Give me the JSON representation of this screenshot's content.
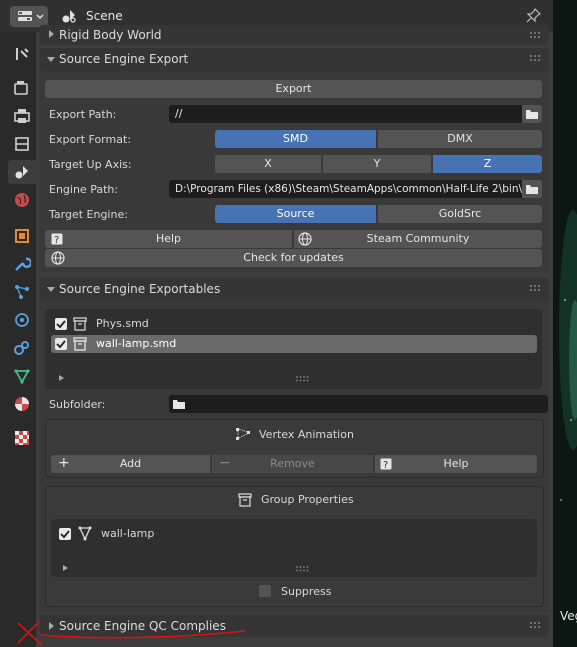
{
  "header": {
    "title": "Scene"
  },
  "panels": {
    "rigid_body_world": {
      "title": "Rigid Body World"
    },
    "source_engine_export": {
      "title": "Source Engine Export",
      "export_button": "Export",
      "export_path_label": "Export Path:",
      "export_path_value": "//",
      "export_format_label": "Export Format:",
      "export_format_options": [
        "SMD",
        "DMX"
      ],
      "export_format_selected": "SMD",
      "target_up_axis_label": "Target Up Axis:",
      "axis_options": [
        "X",
        "Y",
        "Z"
      ],
      "axis_selected": "Z",
      "engine_path_label": "Engine Path:",
      "engine_path_value": "D:\\Program Files (x86)\\Steam\\SteamApps\\common\\Half-Life 2\\bin\\",
      "target_engine_label": "Target Engine:",
      "target_engine_options": [
        "Source",
        "GoldSrc"
      ],
      "target_engine_selected": "Source",
      "help_button": "Help",
      "steam_button": "Steam Community",
      "updates_button": "Check for updates"
    },
    "source_engine_exportables": {
      "title": "Source Engine Exportables",
      "items": [
        {
          "name": "Phys.smd",
          "checked": true,
          "selected": false
        },
        {
          "name": "wall-lamp.smd",
          "checked": true,
          "selected": true
        }
      ],
      "subfolder_label": "Subfolder:",
      "subfolder_value": "",
      "vertex_animation": {
        "title": "Vertex Animation",
        "add": "Add",
        "remove": "Remove",
        "help": "Help"
      },
      "group_properties": {
        "title": "Group Properties",
        "items": [
          {
            "name": "wall-lamp",
            "checked": true
          }
        ],
        "suppress_label": "Suppress",
        "suppress_checked": false
      }
    },
    "source_engine_qc": {
      "title": "Source Engine QC Complies"
    }
  },
  "viewport": {
    "text": "Veg"
  },
  "colors": {
    "accent": "#4772b3",
    "panel": "#3d3d3d",
    "field": "#1d1d1d",
    "button": "#545454",
    "annotation": "#e01010"
  }
}
